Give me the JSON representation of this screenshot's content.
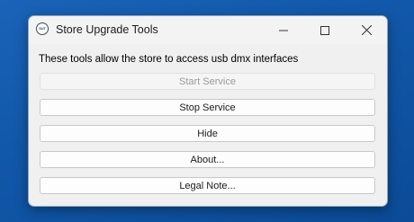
{
  "window": {
    "title": "Store Upgrade Tools",
    "icon_text": "SUT",
    "icon": "app-logo-icon",
    "controls": [
      "minimize-icon",
      "maximize-icon",
      "close-icon"
    ]
  },
  "main": {
    "description": "These tools allow the store to access usb dmx interfaces",
    "buttons": [
      {
        "label": "Start Service",
        "enabled": false
      },
      {
        "label": "Stop Service",
        "enabled": true
      },
      {
        "label": "Hide",
        "enabled": true
      },
      {
        "label": "About...",
        "enabled": true
      },
      {
        "label": "Legal Note...",
        "enabled": true
      }
    ]
  },
  "colors": {
    "desktop": "#1157a8",
    "window_bg": "#f0f0f0",
    "disabled_text": "#9a9a9a"
  }
}
